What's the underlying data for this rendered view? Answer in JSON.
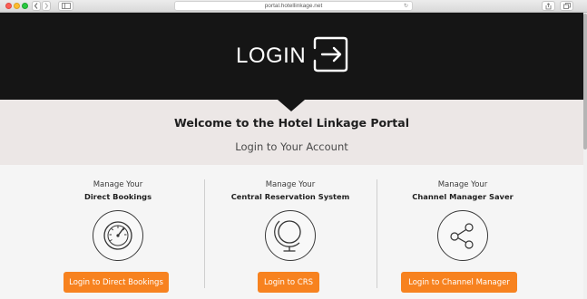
{
  "browser": {
    "url": "portal.hotellinkage.net"
  },
  "banner": {
    "title": "LOGIN"
  },
  "welcome": {
    "title": "Welcome to the Hotel Linkage Portal",
    "subtitle": "Login to Your Account"
  },
  "sections": [
    {
      "line1": "Manage Your",
      "line2": "Direct Bookings",
      "icon": "gauge-icon",
      "button": "Login to Direct Bookings"
    },
    {
      "line1": "Manage Your",
      "line2": "Central Reservation System",
      "icon": "globe-icon",
      "button": "Login to CRS"
    },
    {
      "line1": "Manage Your",
      "line2": "Channel Manager Saver",
      "icon": "share-icon",
      "button": "Login to Channel Manager"
    }
  ],
  "colors": {
    "banner": "#151515",
    "welcome_band": "#ece7e6",
    "accent": "#f7821f"
  }
}
